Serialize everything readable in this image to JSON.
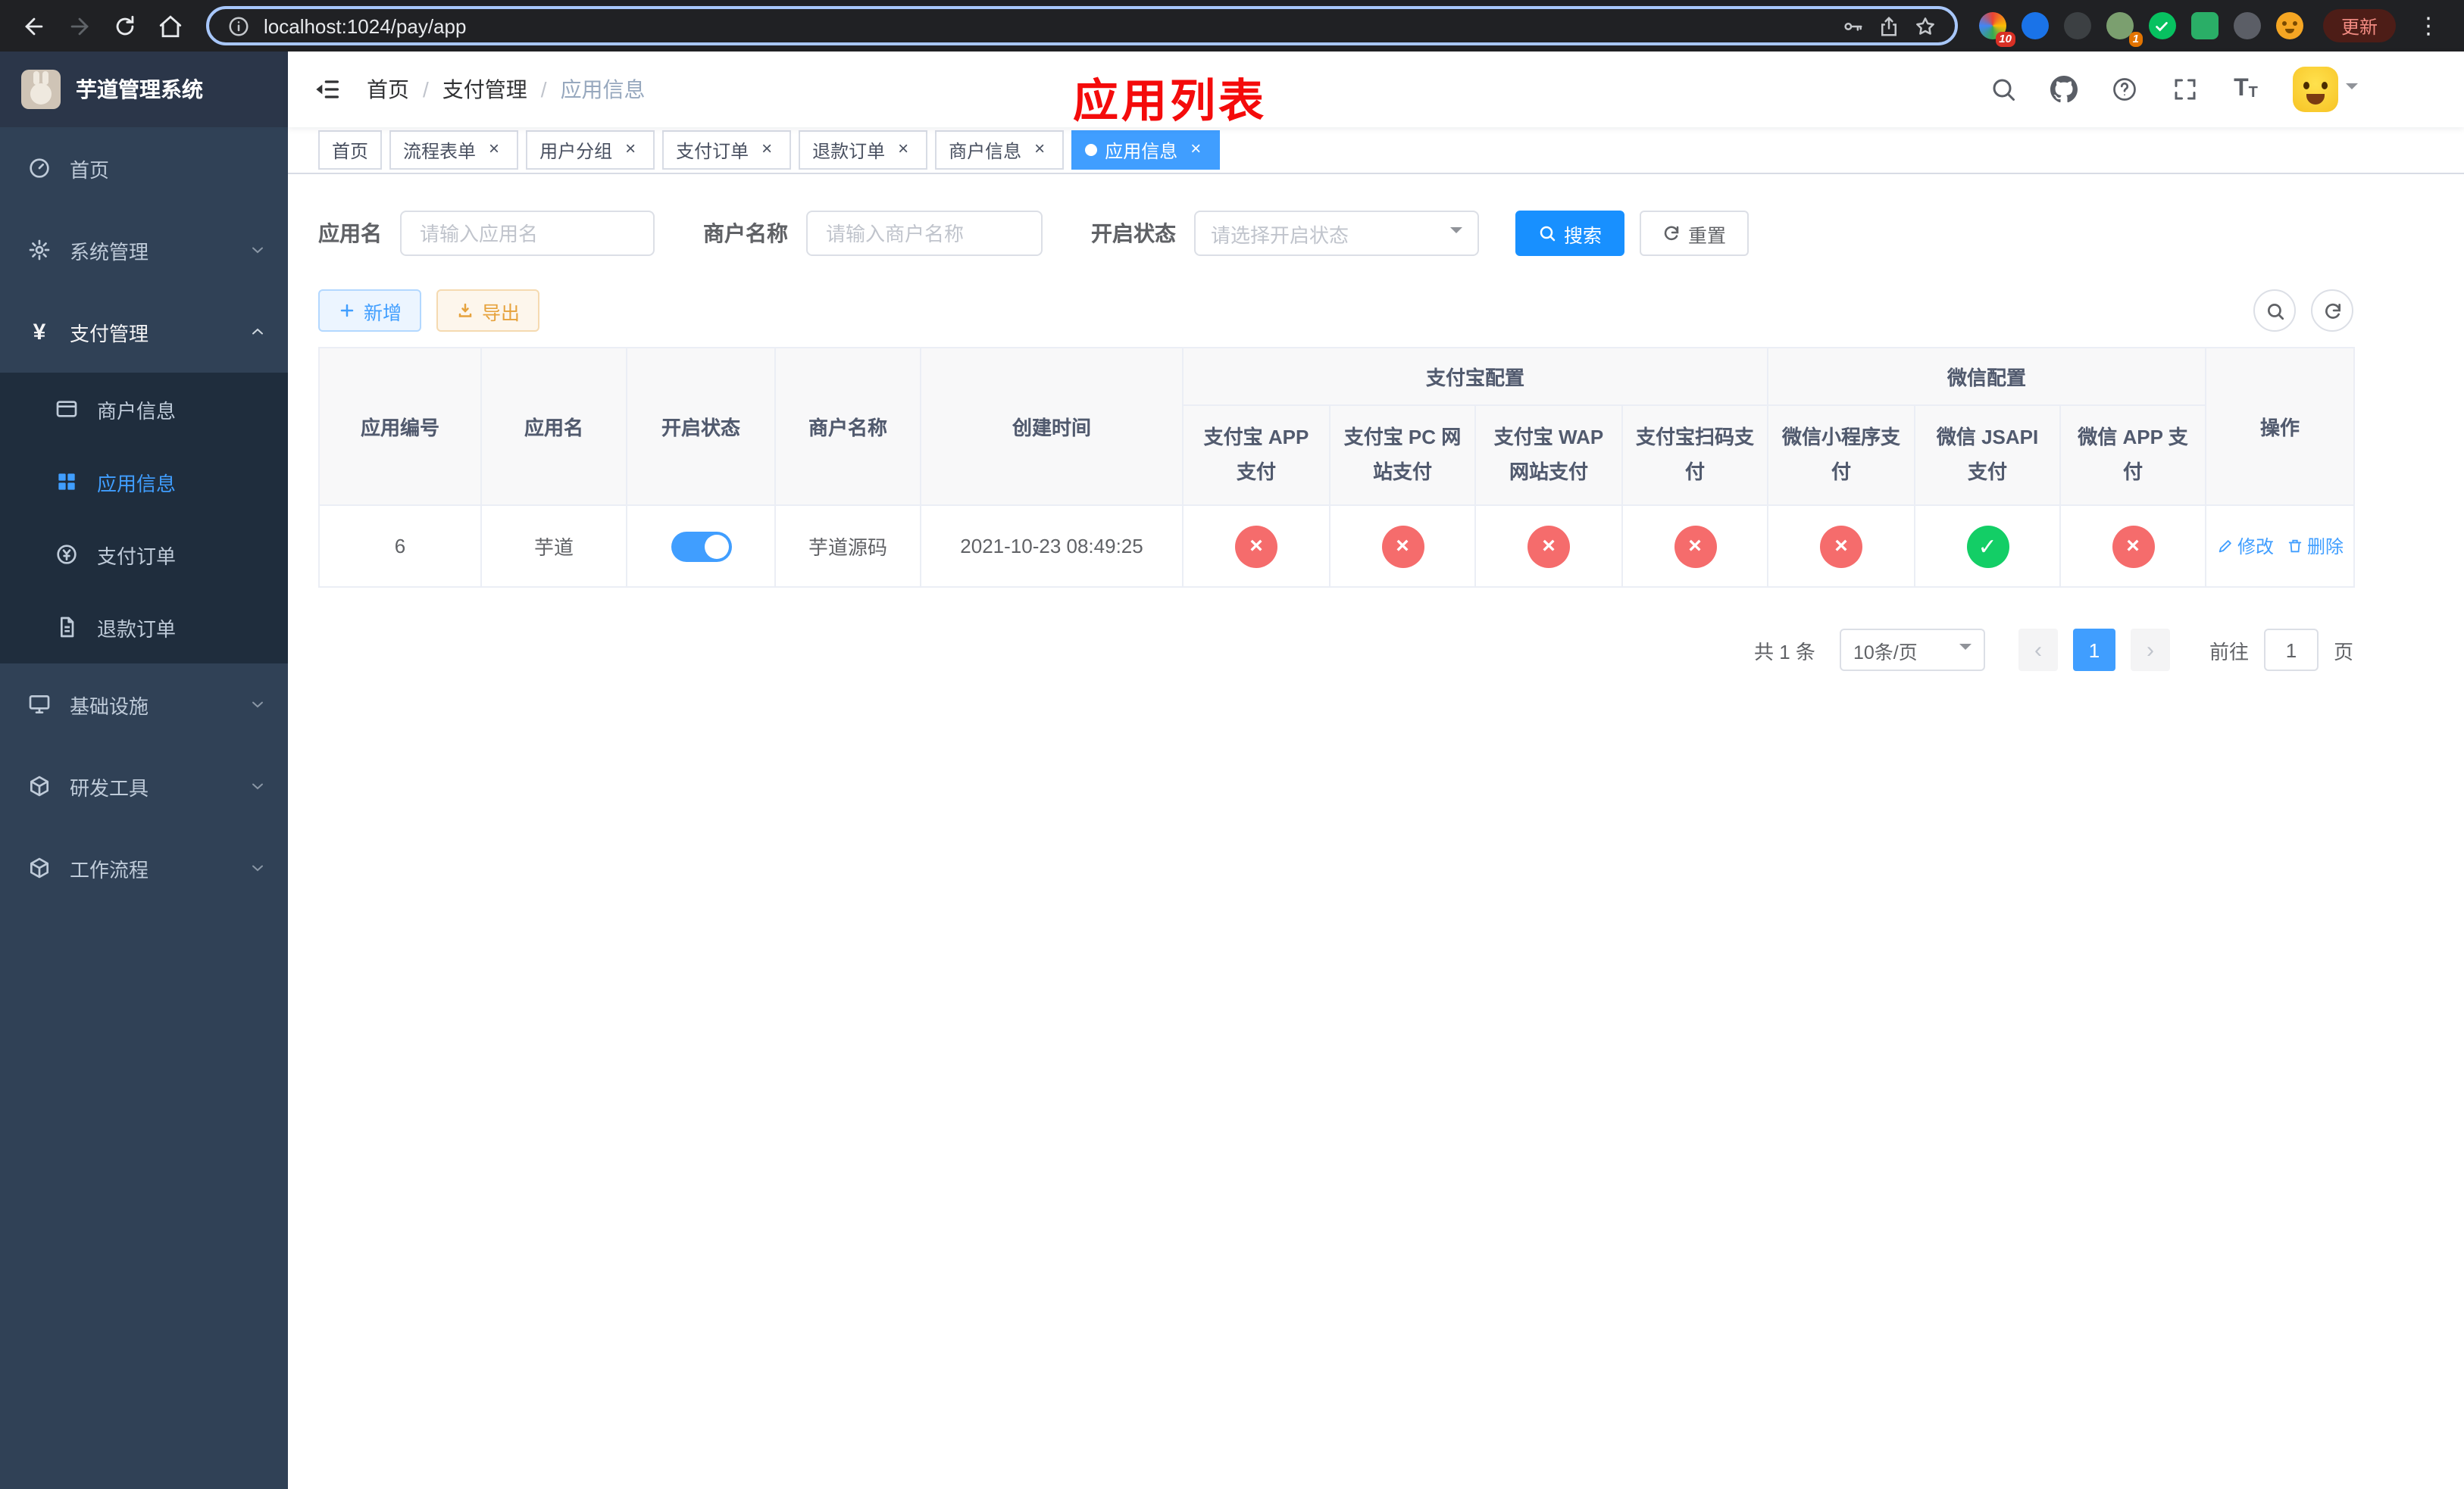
{
  "colors": {
    "accent": "#409eff",
    "title_red": "#f40b0b",
    "success_green": "#13ce66",
    "danger_red": "#f56c6c",
    "warning_orange": "#e6a23c",
    "sidebar_bg": "#304156",
    "submenu_bg": "#1f2d3d"
  },
  "icons": {
    "close": "×",
    "kebab": "⋮",
    "breadcrumb_sep": "/",
    "check": "✓",
    "cross": "×",
    "prev": "‹",
    "next": "›",
    "font_large": "T",
    "font_small": "T",
    "yen": "¥"
  },
  "browser": {
    "url": "localhost:1024/pay/app",
    "update_label": "更新",
    "extension_badge_1": "10",
    "extension_badge_2": "1"
  },
  "sidebar": {
    "title": "芋道管理系统",
    "items": [
      {
        "label": "首页"
      },
      {
        "label": "系统管理"
      },
      {
        "label": "支付管理",
        "children": [
          {
            "label": "商户信息"
          },
          {
            "label": "应用信息"
          },
          {
            "label": "支付订单"
          },
          {
            "label": "退款订单"
          }
        ]
      },
      {
        "label": "基础设施"
      },
      {
        "label": "研发工具"
      },
      {
        "label": "工作流程"
      }
    ]
  },
  "header": {
    "breadcrumb": [
      "首页",
      "支付管理",
      "应用信息"
    ],
    "overlay_title": "应用列表"
  },
  "tabs": [
    {
      "label": "首页"
    },
    {
      "label": "流程表单"
    },
    {
      "label": "用户分组"
    },
    {
      "label": "支付订单"
    },
    {
      "label": "退款订单"
    },
    {
      "label": "商户信息"
    },
    {
      "label": "应用信息"
    }
  ],
  "filters": {
    "app_name_label": "应用名",
    "app_name_placeholder": "请输入应用名",
    "merchant_label": "商户名称",
    "merchant_placeholder": "请输入商户名称",
    "status_label": "开启状态",
    "status_placeholder": "请选择开启状态",
    "search_label": "搜索",
    "reset_label": "重置"
  },
  "toolbar": {
    "add_label": "新增",
    "export_label": "导出"
  },
  "table": {
    "header": {
      "col_id": "应用编号",
      "col_name": "应用名",
      "col_status": "开启状态",
      "col_merchant": "商户名称",
      "col_created": "创建时间",
      "group_alipay": "支付宝配置",
      "group_wechat": "微信配置",
      "col_alipay_app": "支付宝 APP 支付",
      "col_alipay_pc": "支付宝 PC 网站支付",
      "col_alipay_wap": "支付宝 WAP 网站支付",
      "col_alipay_qr": "支付宝扫码支付",
      "col_wx_lite": "微信小程序支付",
      "col_wx_jsapi": "微信 JSAPI 支付",
      "col_wx_app": "微信 APP 支付",
      "col_actions": "操作"
    },
    "rows": [
      {
        "id": "6",
        "name": "芋道",
        "enabled": true,
        "merchant": "芋道源码",
        "created": "2021-10-23 08:49:25",
        "alipay_app": false,
        "alipay_pc": false,
        "alipay_wap": false,
        "alipay_qr": false,
        "wx_lite": false,
        "wx_jsapi": true,
        "wx_app": false,
        "edit_label": "修改",
        "delete_label": "删除"
      }
    ]
  },
  "pagination": {
    "total": "共 1 条",
    "page_size": "10条/页",
    "page": "1",
    "goto_label": "前往",
    "goto_value": "1",
    "page_unit": "页"
  }
}
